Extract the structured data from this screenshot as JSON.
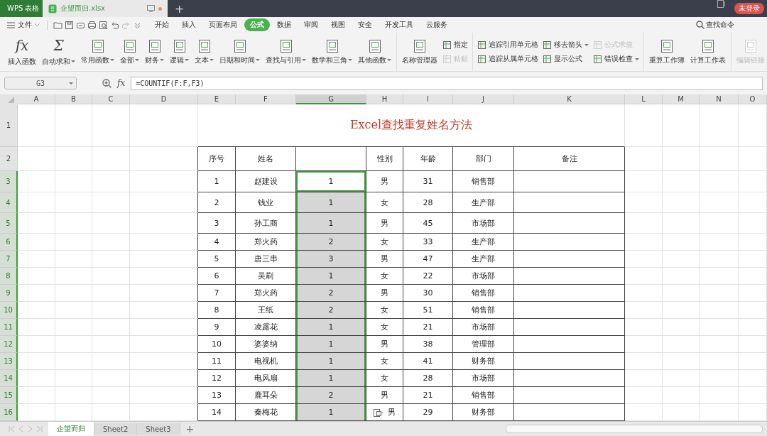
{
  "title_bar": {
    "app_tab": "WPS 表格",
    "file_tab": {
      "name": "企望而归.xlsx",
      "unsaved": true
    },
    "new_tab": "+",
    "login": "未登录"
  },
  "menu_bar": {
    "file_menu": "文件",
    "tabs": [
      {
        "label": "开始",
        "selected": false
      },
      {
        "label": "插入",
        "selected": false
      },
      {
        "label": "页面布局",
        "selected": false
      },
      {
        "label": "公式",
        "selected": true
      },
      {
        "label": "数据",
        "selected": false
      },
      {
        "label": "审阅",
        "selected": false
      },
      {
        "label": "视图",
        "selected": false
      },
      {
        "label": "安全",
        "selected": false
      },
      {
        "label": "开发工具",
        "selected": false
      },
      {
        "label": "云服务",
        "selected": false
      }
    ],
    "search": "查找命令"
  },
  "ribbon": {
    "groups": [
      {
        "items": [
          {
            "kind": "large",
            "label": "插入函数",
            "glyph": "fx",
            "dropdown": false,
            "disabled": false
          },
          {
            "kind": "large",
            "label": "自动求和",
            "glyph": "Σ",
            "dropdown": true,
            "disabled": false
          },
          {
            "kind": "large",
            "label": "常用函数",
            "dropdown": true,
            "disabled": false
          },
          {
            "kind": "large",
            "label": "全部",
            "dropdown": true,
            "disabled": false
          },
          {
            "kind": "large",
            "label": "财务",
            "dropdown": true,
            "disabled": false
          },
          {
            "kind": "large",
            "label": "逻辑",
            "dropdown": true,
            "disabled": false
          },
          {
            "kind": "large",
            "label": "文本",
            "dropdown": true,
            "disabled": false
          },
          {
            "kind": "large",
            "label": "日期和时间",
            "dropdown": true,
            "disabled": false
          },
          {
            "kind": "large",
            "label": "查找与引用",
            "dropdown": true,
            "disabled": false
          },
          {
            "kind": "large",
            "label": "数学和三角",
            "dropdown": true,
            "disabled": false
          },
          {
            "kind": "large",
            "label": "其他函数",
            "dropdown": true,
            "disabled": false
          }
        ]
      },
      {
        "items": [
          {
            "kind": "large",
            "label": "名称管理器",
            "dropdown": false,
            "disabled": false
          },
          {
            "kind": "stack",
            "items": [
              {
                "label": "指定",
                "dropdown": false,
                "disabled": false
              },
              {
                "label": "粘贴",
                "dropdown": false,
                "disabled": true
              }
            ]
          }
        ]
      },
      {
        "items": [
          {
            "kind": "stack",
            "items": [
              {
                "label": "追踪引用单元格",
                "dropdown": false,
                "disabled": false
              },
              {
                "label": "追踪从属单元格",
                "dropdown": false,
                "disabled": false
              }
            ]
          },
          {
            "kind": "stack",
            "items": [
              {
                "label": "移去箭头",
                "dropdown": true,
                "disabled": false
              },
              {
                "label": "显示公式",
                "dropdown": false,
                "disabled": false
              }
            ]
          },
          {
            "kind": "stack",
            "items": [
              {
                "label": "公式求值",
                "dropdown": false,
                "disabled": true
              },
              {
                "label": "错误检查",
                "dropdown": true,
                "disabled": false
              }
            ]
          }
        ]
      },
      {
        "items": [
          {
            "kind": "large",
            "label": "重算工作簿",
            "dropdown": false,
            "disabled": false
          },
          {
            "kind": "large",
            "label": "计算工作表",
            "dropdown": false,
            "disabled": false
          }
        ]
      },
      {
        "items": [
          {
            "kind": "large",
            "label": "编辑链接",
            "dropdown": false,
            "disabled": true
          }
        ]
      }
    ]
  },
  "formula_bar": {
    "cell_ref": "G3",
    "fx": "fx",
    "formula": "=COUNTIF(F:F,F3)"
  },
  "sheet": {
    "columns": [
      {
        "label": "A",
        "selected": false
      },
      {
        "label": "B",
        "selected": false
      },
      {
        "label": "C",
        "selected": false
      },
      {
        "label": "D",
        "selected": false
      },
      {
        "label": "E",
        "selected": false
      },
      {
        "label": "F",
        "selected": false
      },
      {
        "label": "G",
        "selected": true
      },
      {
        "label": "H",
        "selected": false
      },
      {
        "label": "I",
        "selected": false
      },
      {
        "label": "J",
        "selected": false
      },
      {
        "label": "K",
        "selected": false
      },
      {
        "label": "L",
        "selected": false
      },
      {
        "label": "M",
        "selected": false
      },
      {
        "label": "N",
        "selected": false
      },
      {
        "label": "O",
        "selected": false
      }
    ],
    "rows": [
      {
        "label": "1",
        "selected": false
      },
      {
        "label": "2",
        "selected": false
      },
      {
        "label": "3",
        "selected": true
      },
      {
        "label": "4",
        "selected": true
      },
      {
        "label": "5",
        "selected": true
      },
      {
        "label": "6",
        "selected": true
      },
      {
        "label": "7",
        "selected": true
      },
      {
        "label": "8",
        "selected": true
      },
      {
        "label": "9",
        "selected": true
      },
      {
        "label": "10",
        "selected": true
      },
      {
        "label": "11",
        "selected": true
      },
      {
        "label": "12",
        "selected": true
      },
      {
        "label": "13",
        "selected": true
      },
      {
        "label": "14",
        "selected": true
      },
      {
        "label": "15",
        "selected": true
      },
      {
        "label": "16",
        "selected": true
      }
    ],
    "title": "Excel查找重复姓名方法",
    "header_left": [
      "序号",
      "姓名"
    ],
    "header_right": [
      "性别",
      "年龄",
      "部门",
      "备注"
    ],
    "records": [
      {
        "cells": [
          "1",
          "赵建设",
          "1",
          "男",
          "31",
          "销售部"
        ],
        "selected": true,
        "active": true
      },
      {
        "cells": [
          "2",
          "钱业",
          "1",
          "女",
          "28",
          "生产部"
        ],
        "selected": true,
        "active": false
      },
      {
        "cells": [
          "3",
          "孙工商",
          "1",
          "男",
          "45",
          "市场部"
        ],
        "selected": true,
        "active": false
      },
      {
        "cells": [
          "4",
          "郑火药",
          "2",
          "女",
          "33",
          "生产部"
        ],
        "selected": true,
        "active": false
      },
      {
        "cells": [
          "5",
          "唐三串",
          "3",
          "男",
          "47",
          "生产部"
        ],
        "selected": true,
        "active": false
      },
      {
        "cells": [
          "6",
          "吴刷",
          "1",
          "女",
          "22",
          "市场部"
        ],
        "selected": true,
        "active": false
      },
      {
        "cells": [
          "7",
          "郑火药",
          "2",
          "男",
          "30",
          "销售部"
        ],
        "selected": true,
        "active": false
      },
      {
        "cells": [
          "8",
          "王纸",
          "2",
          "女",
          "51",
          "销售部"
        ],
        "selected": true,
        "active": false
      },
      {
        "cells": [
          "9",
          "凌露花",
          "1",
          "女",
          "21",
          "市场部"
        ],
        "selected": true,
        "active": false
      },
      {
        "cells": [
          "10",
          "婆婆纳",
          "1",
          "男",
          "38",
          "管理部"
        ],
        "selected": true,
        "active": false
      },
      {
        "cells": [
          "11",
          "电视机",
          "1",
          "女",
          "41",
          "财务部"
        ],
        "selected": true,
        "active": false
      },
      {
        "cells": [
          "12",
          "电风扇",
          "1",
          "女",
          "28",
          "市场部"
        ],
        "selected": true,
        "active": false
      },
      {
        "cells": [
          "13",
          "鹿耳朵",
          "2",
          "男",
          "21",
          "销售部"
        ],
        "selected": true,
        "active": false
      },
      {
        "cells": [
          "14",
          "秦梅花",
          "1",
          "男",
          "29",
          "财务部"
        ],
        "selected": true,
        "active": false
      }
    ],
    "paste_options": true
  },
  "sheet_tabs": {
    "tabs": [
      {
        "label": "企望而归",
        "selected": true
      },
      {
        "label": "Sheet2",
        "selected": false
      },
      {
        "label": "Sheet3",
        "selected": false
      }
    ],
    "add": "+"
  }
}
